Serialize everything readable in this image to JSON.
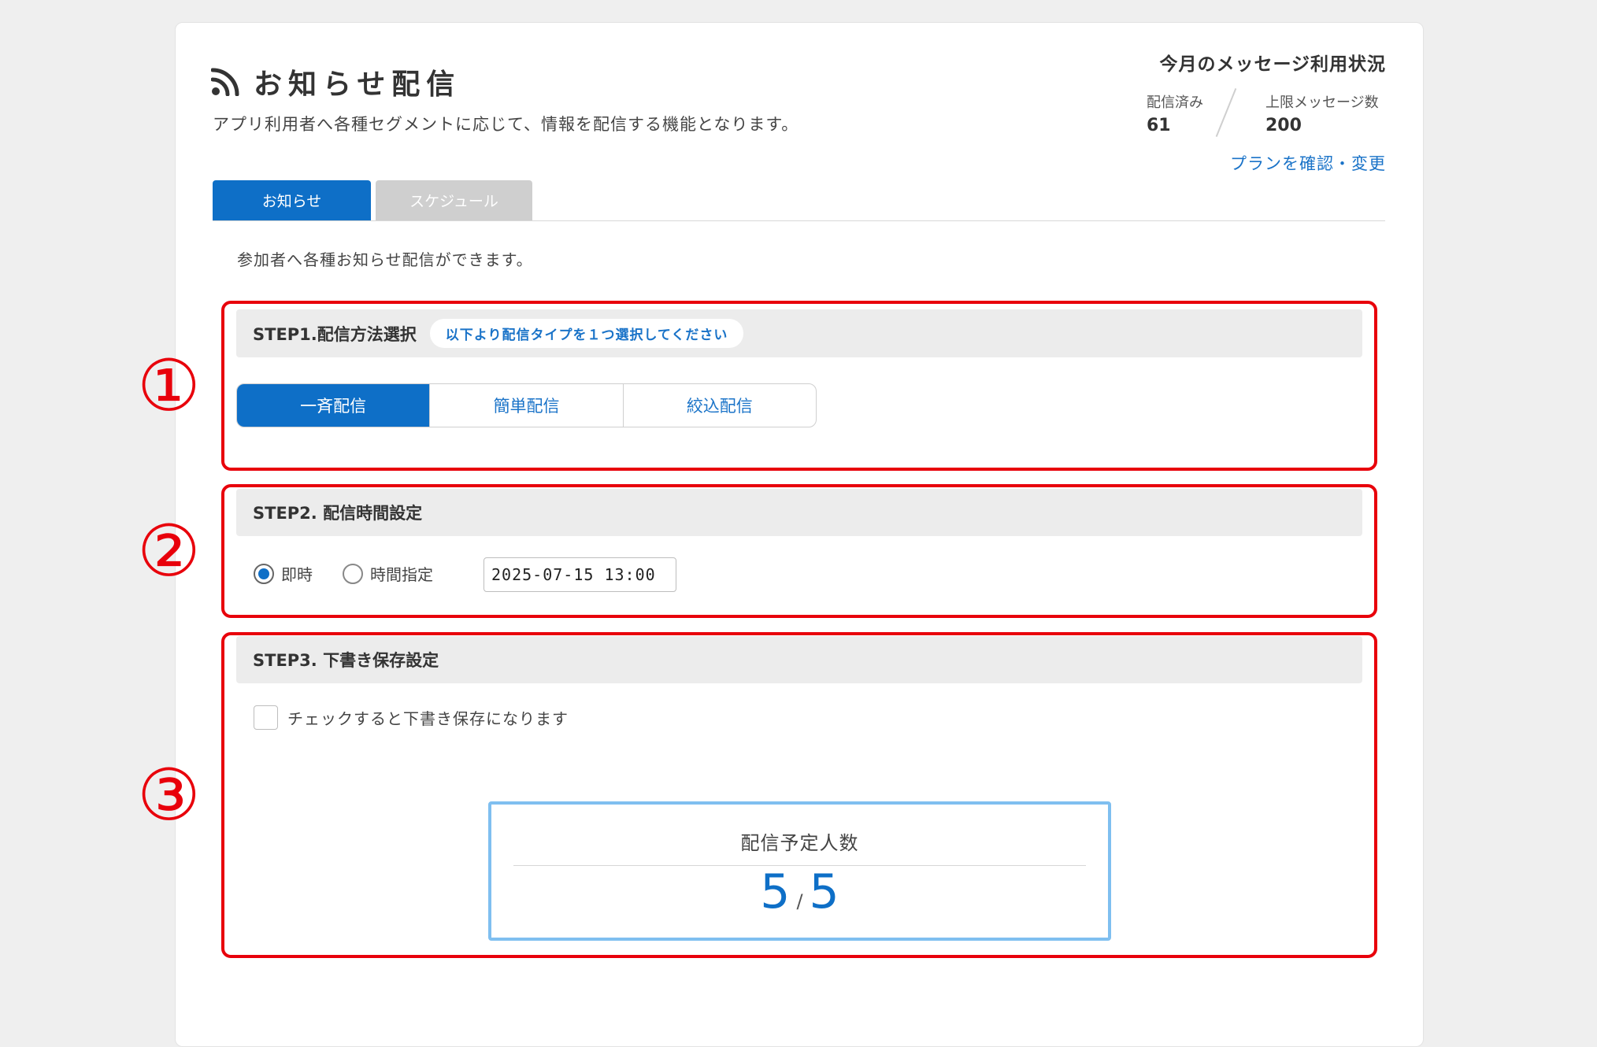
{
  "header": {
    "title": "お知らせ配信",
    "description": "アプリ利用者へ各種セグメントに応じて、情報を配信する機能となります。",
    "icon": "rss-icon"
  },
  "usage": {
    "title": "今月のメッセージ利用状況",
    "sent_label": "配信済み",
    "sent_value": "61",
    "limit_label": "上限メッセージ数",
    "limit_value": "200",
    "plan_link": "プランを確認・変更"
  },
  "tabs": [
    {
      "label": "お知らせ",
      "active": true
    },
    {
      "label": "スケジュール",
      "active": false
    }
  ],
  "intro": "参加者へ各種お知らせ配信ができます。",
  "annotations": [
    "①",
    "②",
    "③"
  ],
  "step1": {
    "title": "STEP1.配信方法選択",
    "hint": "以下より配信タイプを１つ選択してください",
    "options": [
      "一斉配信",
      "簡単配信",
      "絞込配信"
    ],
    "selected": "一斉配信"
  },
  "step2": {
    "title": "STEP2. 配信時間設定",
    "radio_immediate": "即時",
    "radio_scheduled": "時間指定",
    "datetime_value": "2025-07-15 13:00"
  },
  "step3": {
    "title": "STEP3. 下書き保存設定",
    "checkbox_label": "チェックすると下書き保存になります"
  },
  "recipients": {
    "title": "配信予定人数",
    "count": "5",
    "separator": "/",
    "total": "5"
  },
  "colors": {
    "accent": "#0e6fc7",
    "link": "#1a73c8",
    "annotation_red": "#e8000b",
    "recipient_border": "#7fbff0"
  }
}
